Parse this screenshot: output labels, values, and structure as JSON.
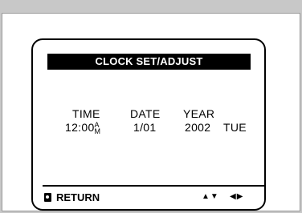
{
  "menu": {
    "title": "CLOCK SET/ADJUST",
    "headers": {
      "time": "TIME",
      "date": "DATE",
      "year": "YEAR"
    },
    "values": {
      "time": "12:00",
      "ampm_top": "A",
      "ampm_bottom": "M",
      "date": "1/01",
      "year": "2002",
      "day": "TUE"
    }
  },
  "footer": {
    "return_label": "RETURN",
    "return_icon": "return-button-icon",
    "updown_arrows": "▲▼",
    "leftright_arrows": "◀▶"
  }
}
